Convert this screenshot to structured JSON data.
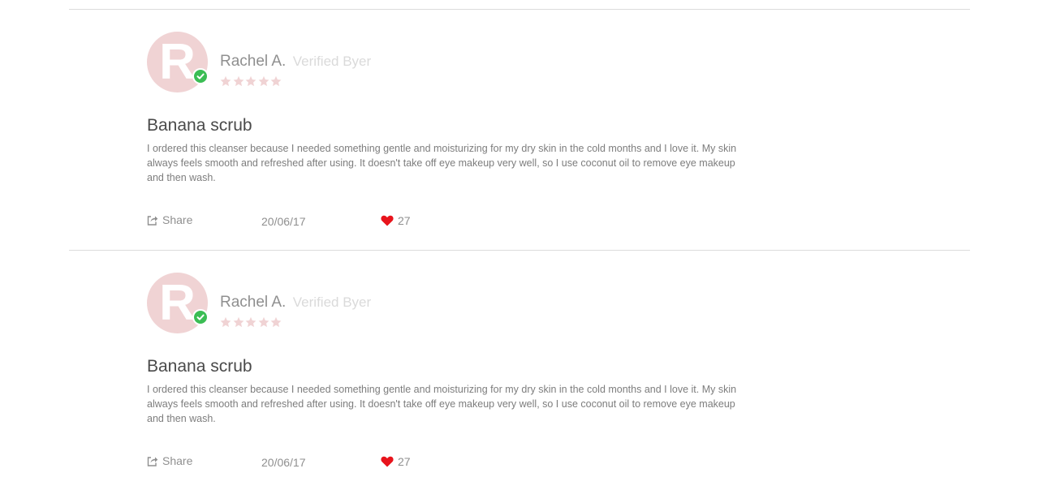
{
  "colors": {
    "avatar_bg": "#f0d3d4",
    "verified_badge": "#3bbd54",
    "star_empty": "#f0d3d4",
    "heart": "#e8141c",
    "divider": "#dcdcdc"
  },
  "reviews": [
    {
      "avatar_initial": "R",
      "reviewer_name": "Rachel A.",
      "verified_label": "Verified Byer",
      "rating": 0,
      "rating_max": 5,
      "title": "Banana scrub",
      "body": "I ordered this cleanser because I needed something gentle and moisturizing for my dry skin in the cold months and I love it. My skin always feels smooth and refreshed after using. It doesn't take off eye makeup very well, so I use coconut oil to remove eye makeup and then wash.",
      "share_label": "Share",
      "date": "20/06/17",
      "likes": "27"
    },
    {
      "avatar_initial": "R",
      "reviewer_name": "Rachel A.",
      "verified_label": "Verified Byer",
      "rating": 0,
      "rating_max": 5,
      "title": "Banana scrub",
      "body": "I ordered this cleanser because I needed something gentle and moisturizing for my dry skin in the cold months and I love it. My skin always feels smooth and refreshed after using. It doesn't take off eye makeup very well, so I use coconut oil to remove eye makeup and then wash.",
      "share_label": "Share",
      "date": "20/06/17",
      "likes": "27"
    }
  ]
}
